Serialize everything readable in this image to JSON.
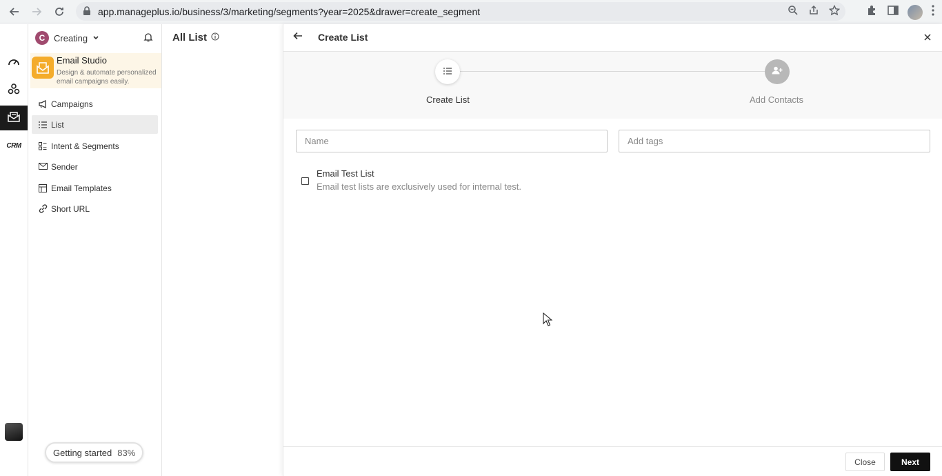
{
  "browser": {
    "url": "app.manageplus.io/business/3/marketing/segments?year=2025&drawer=create_segment"
  },
  "workspace": {
    "logo_letter": "C",
    "name": "Creating"
  },
  "studio": {
    "title": "Email Studio",
    "description": "Design & automate personalized email campaigns easily."
  },
  "sidebar": {
    "items": [
      {
        "label": "Campaigns",
        "icon": "megaphone-icon"
      },
      {
        "label": "List",
        "icon": "list-icon",
        "active": true
      },
      {
        "label": "Intent & Segments",
        "icon": "segments-icon"
      },
      {
        "label": "Sender",
        "icon": "mail-send-icon"
      },
      {
        "label": "Email Templates",
        "icon": "template-icon"
      },
      {
        "label": "Short URL",
        "icon": "link-icon"
      }
    ]
  },
  "rail": {
    "items": [
      "dashboard-icon",
      "integrations-icon",
      "email-studio-icon",
      "crm-icon"
    ],
    "crm_label": "CRM"
  },
  "getting_started": {
    "label": "Getting started",
    "percent": "83%"
  },
  "middle": {
    "title": "All List"
  },
  "drawer": {
    "title": "Create List",
    "steps": [
      {
        "label": "Create List",
        "state": "current"
      },
      {
        "label": "Add Contacts",
        "state": "pending"
      }
    ],
    "name_placeholder": "Name",
    "tags_placeholder": "Add tags",
    "test_list": {
      "title": "Email Test List",
      "description": "Email test lists are exclusively used for internal test.",
      "checked": false
    },
    "close_label": "Close",
    "next_label": "Next"
  },
  "colors": {
    "accent": "#111111",
    "studio_bg": "#fdf6e7",
    "studio_icon": "#f4ac2b",
    "workspace_logo": "#a04a6e"
  }
}
